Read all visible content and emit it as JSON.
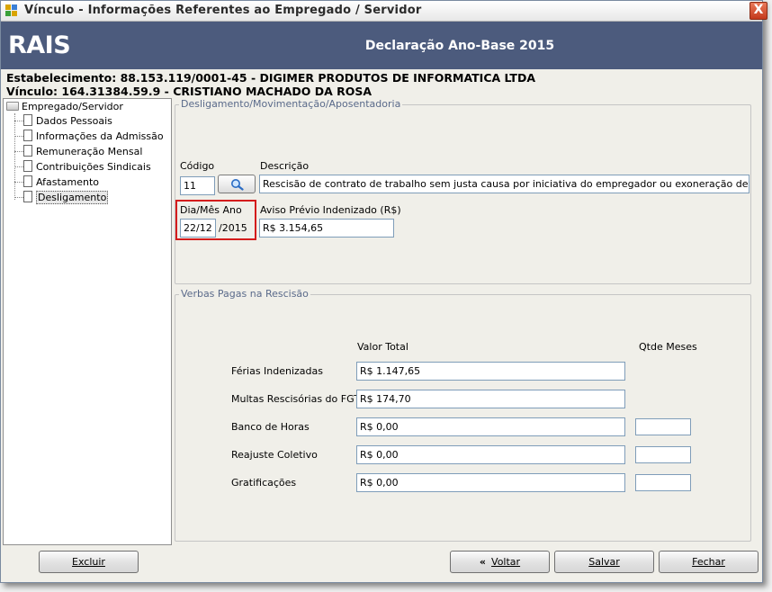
{
  "window": {
    "title": "Vínculo - Informações Referentes ao Empregado / Servidor",
    "close_label": "X"
  },
  "header": {
    "logo": "RAIS",
    "title": "Declaração Ano-Base 2015"
  },
  "info": {
    "estabelecimento": "Estabelecimento: 88.153.119/0001-45 - DIGIMER PRODUTOS DE INFORMATICA LTDA",
    "vinculo": "Vínculo: 164.31384.59.9 - CRISTIANO MACHADO DA ROSA"
  },
  "tree": {
    "root": "Empregado/Servidor",
    "items": [
      {
        "label": "Dados Pessoais"
      },
      {
        "label": "Informações da Admissão"
      },
      {
        "label": "Remuneração Mensal"
      },
      {
        "label": "Contribuições Sindicais"
      },
      {
        "label": "Afastamento"
      },
      {
        "label": "Desligamento",
        "selected": true
      }
    ]
  },
  "desligamento": {
    "legend": "Desligamento/Movimentação/Aposentadoria",
    "codigo_label": "Código",
    "codigo_value": "11",
    "descricao_label": "Descrição",
    "descricao_value": "Rescisão de contrato de trabalho sem justa causa por iniciativa do empregador ou exoneração de ofício de servi",
    "dia_mes_label": "Dia/Mês Ano",
    "dia_mes_value": "22/12",
    "ano_value": "/2015",
    "aviso_label": "Aviso Prévio Indenizado (R$)",
    "aviso_value": "R$ 3.154,65"
  },
  "verbas": {
    "legend": "Verbas Pagas na Rescisão",
    "valor_total_header": "Valor Total",
    "qtde_meses_header": "Qtde Meses",
    "rows": [
      {
        "label": "Férias Indenizadas",
        "value": "R$ 1.147,65"
      },
      {
        "label": "Multas Rescisórias do FGTS",
        "value": "R$ 174,70"
      },
      {
        "label": "Banco de Horas",
        "value": "R$ 0,00",
        "qtde": ""
      },
      {
        "label": "Reajuste Coletivo",
        "value": "R$ 0,00",
        "qtde": ""
      },
      {
        "label": "Gratificações",
        "value": "R$ 0,00",
        "qtde": ""
      }
    ]
  },
  "buttons": {
    "excluir": "Excluir",
    "voltar": "Voltar",
    "salvar": "Salvar",
    "fechar": "Fechar"
  },
  "colors": {
    "header_bg": "#4c5b7d",
    "highlight": "#d41c1c",
    "close_button": "#c4391c"
  }
}
